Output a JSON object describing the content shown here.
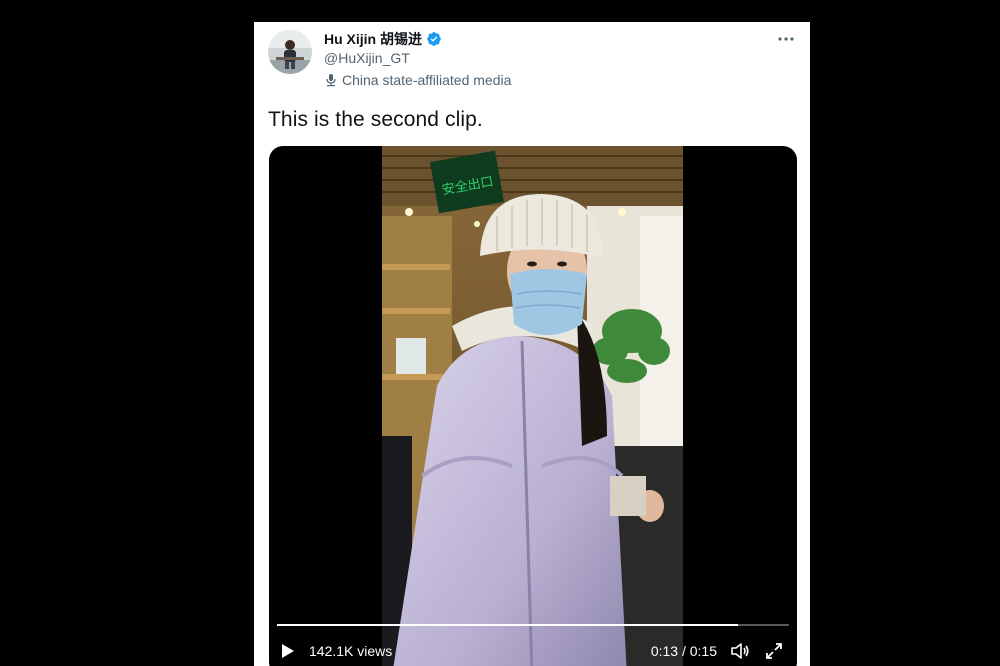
{
  "author": {
    "display_name": "Hu Xijin 胡锡进",
    "handle": "@HuXijin_GT",
    "affiliation_label": "China state-affiliated media",
    "verified_icon": "verified-badge-icon",
    "affiliation_icon": "microphone-stand-icon"
  },
  "tweet": {
    "text": "This is the second clip."
  },
  "video": {
    "sign_text": "安全出口",
    "views_count": "142.1K",
    "views_label": "views",
    "current_time": "0:13",
    "separator": "/",
    "duration": "0:15",
    "progress": 0.9
  },
  "icons": {
    "more": "more-options-icon",
    "play": "play-icon",
    "volume": "volume-icon",
    "fullscreen": "fullscreen-icon"
  },
  "colors": {
    "accent": "#1d9bf0",
    "text_primary": "#0f1419",
    "text_secondary": "#536471",
    "exit_sign": "#2fd16a"
  }
}
